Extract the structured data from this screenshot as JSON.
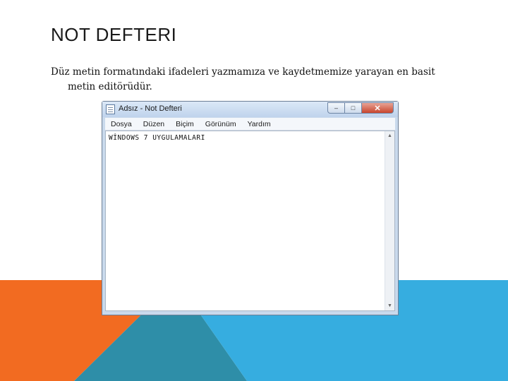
{
  "slide": {
    "title": "NOT DEFTERI",
    "body_line1": "Düz metin formatındaki ifadeleri yazmamıza ve kaydetmemize yarayan en basit",
    "body_line2": "metin editörüdür."
  },
  "window": {
    "title": "Adsız - Not Defteri",
    "controls": {
      "minimize": "–",
      "maximize": "□",
      "close": "✕"
    },
    "menu": [
      "Dosya",
      "Düzen",
      "Biçim",
      "Görünüm",
      "Yardım"
    ],
    "content": "WİNDOWS 7 UYGULAMALARI",
    "scroll_up": "▲",
    "scroll_down": "▼"
  },
  "colors": {
    "orange": "#f26b21",
    "teal_dark": "#2e8ea8",
    "blue_light": "#36ade0"
  }
}
